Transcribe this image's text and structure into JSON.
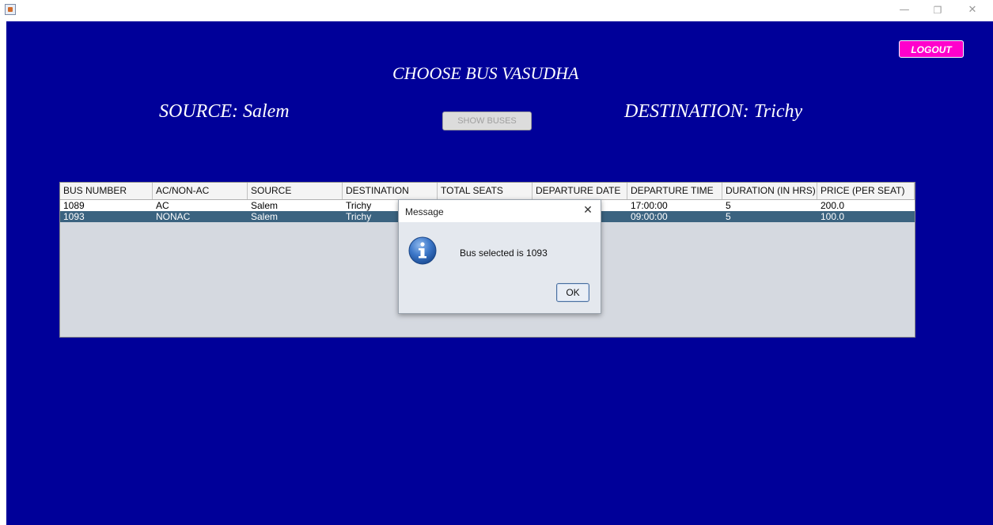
{
  "window": {
    "minimize_glyph": "—",
    "restore_glyph": "❐",
    "close_glyph": "✕",
    "app_icon": "java-cup-icon"
  },
  "header": {
    "title": "CHOOSE BUS VASUDHA",
    "source": "SOURCE: Salem",
    "destination": "DESTINATION: Trichy"
  },
  "logout_label": "LOGOUT",
  "show_buses_label": "SHOW BUSES",
  "colors": {
    "background": "#000099",
    "logout": "#ff00cc",
    "selected_row": "#3b6380"
  },
  "table": {
    "columns": [
      "BUS NUMBER",
      "AC/NON-AC",
      "SOURCE",
      "DESTINATION",
      "TOTAL SEATS",
      "DEPARTURE DATE",
      "DEPARTURE TIME",
      "DURATION (IN HRS)",
      "PRICE (PER SEAT)"
    ],
    "rows": [
      [
        "1089",
        "AC",
        "Salem",
        "Trichy",
        "",
        "",
        "17:00:00",
        "5",
        "200.0"
      ],
      [
        "1093",
        "NONAC",
        "Salem",
        "Trichy",
        "",
        "",
        "09:00:00",
        "5",
        "100.0"
      ]
    ],
    "selected_row": 1
  },
  "dialog": {
    "title": "Message",
    "close_glyph": "✕",
    "message": "Bus selected is 1093",
    "ok_label": "OK",
    "icon": "info-icon"
  }
}
